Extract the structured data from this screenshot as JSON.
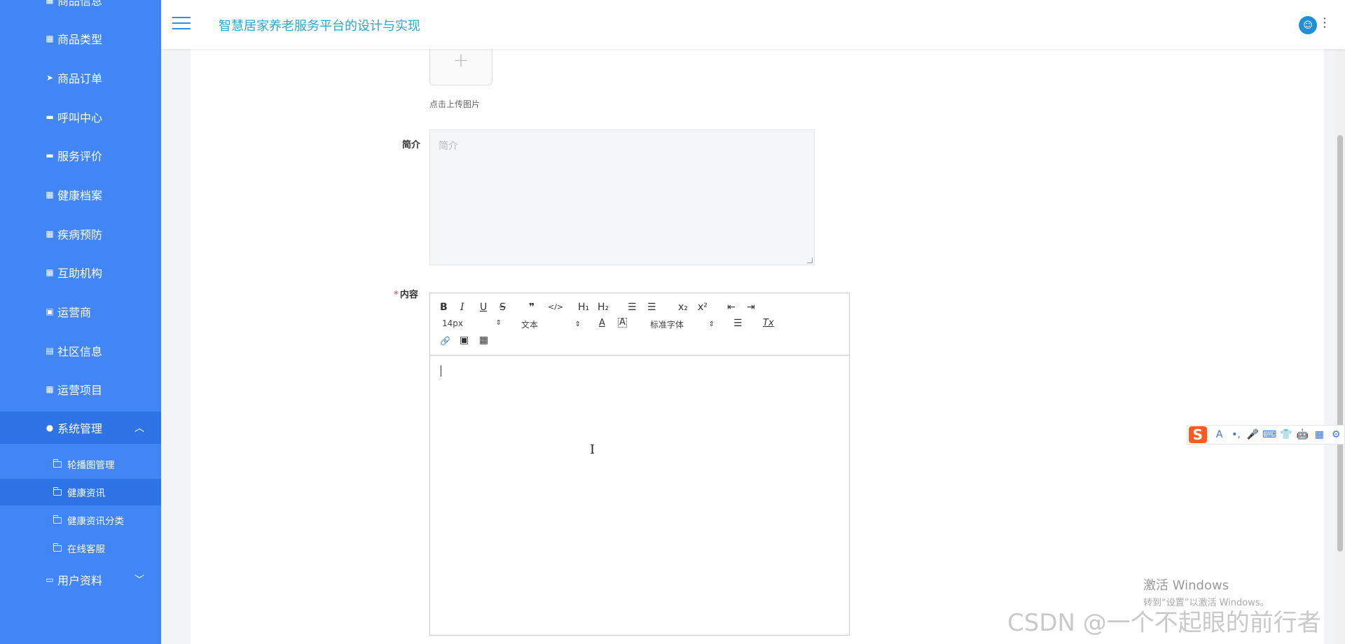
{
  "app": {
    "title": "智慧居家养老服务平台的设计与实现"
  },
  "sidebar": {
    "items": [
      {
        "label": "商品信息",
        "icon": "grid-icon"
      },
      {
        "label": "商品类型",
        "icon": "grid-icon"
      },
      {
        "label": "商品订单",
        "icon": "send-icon"
      },
      {
        "label": "呼叫中心",
        "icon": "monitor-icon"
      },
      {
        "label": "服务评价",
        "icon": "monitor-icon"
      },
      {
        "label": "健康档案",
        "icon": "grid-icon"
      },
      {
        "label": "疾病预防",
        "icon": "grid-icon"
      },
      {
        "label": "互助机构",
        "icon": "grid-icon"
      },
      {
        "label": "运营商",
        "icon": "briefcase-icon"
      },
      {
        "label": "社区信息",
        "icon": "file-icon"
      },
      {
        "label": "运营项目",
        "icon": "grid-icon"
      },
      {
        "label": "系统管理",
        "icon": "user-icon"
      },
      {
        "label": "用户资料",
        "icon": "calendar-icon"
      }
    ],
    "submenu": [
      {
        "label": "轮播图管理"
      },
      {
        "label": "健康资讯"
      },
      {
        "label": "健康资讯分类"
      },
      {
        "label": "在线客服"
      }
    ]
  },
  "form": {
    "upload_tip": "点击上传图片",
    "upload_plus": "+",
    "intro_label": "简介",
    "intro_placeholder": "简介",
    "content_label": "内容",
    "required_mark": "*"
  },
  "editor": {
    "toolbar": {
      "bold": "B",
      "italic": "I",
      "underline": "U",
      "strike": "S",
      "quote": "❞",
      "code": "</>",
      "h1": "H₁",
      "h2": "H₂",
      "ordered_list": "☰",
      "bullet_list": "☰",
      "sub": "x₂",
      "sup": "x²",
      "outdent": "⇤",
      "indent": "⇥",
      "size": "14px",
      "paragraph": "文本",
      "font_color": "A",
      "bg_color": "A",
      "font_family": "标准字体",
      "align": "☰",
      "clean": "Tx",
      "link": "🔗",
      "image": "▣",
      "video": "▦"
    }
  },
  "ime": {
    "logo": "S",
    "icons": [
      "A",
      "•,",
      "🎤",
      "⌨",
      "👕",
      "🤖",
      "▦",
      "⚙"
    ]
  },
  "watermark": {
    "win_title": "激活 Windows",
    "win_sub": "转到“设置”以激活 Windows。",
    "csdn": "CSDN @一个不起眼的前行者"
  },
  "colors": {
    "sidebar": "#4186f4",
    "sidebar_active": "#2f74e6",
    "title": "#2aa7cf"
  }
}
